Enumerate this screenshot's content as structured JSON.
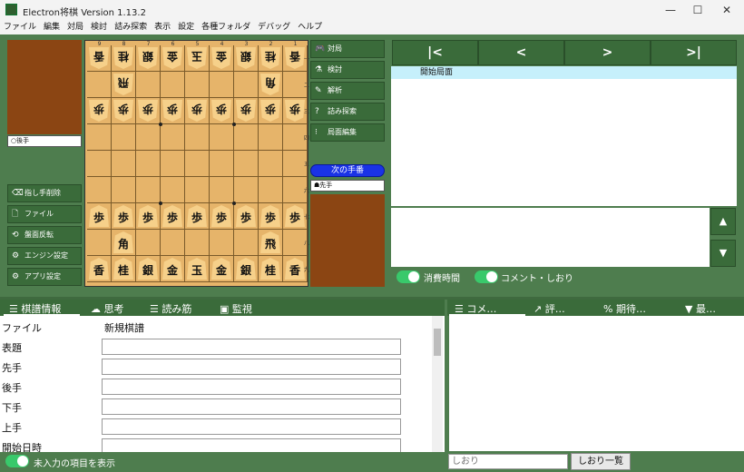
{
  "window": {
    "title": "Electron将棋 Version 1.13.2",
    "minimize": "—",
    "maximize": "☐",
    "close": "✕"
  },
  "menu": [
    "ファイル",
    "編集",
    "対局",
    "検討",
    "詰み探索",
    "表示",
    "設定",
    "各種フォルダ",
    "デバッグ",
    "ヘルプ"
  ],
  "gote_label": "○後手",
  "sente_label": "☗先手",
  "next_turn": "次の手番",
  "file_labels": [
    "9",
    "8",
    "7",
    "6",
    "5",
    "4",
    "3",
    "2",
    "1"
  ],
  "rank_labels": [
    "一",
    "二",
    "三",
    "四",
    "五",
    "六",
    "七",
    "八",
    "九"
  ],
  "board": [
    [
      "香v",
      "桂v",
      "銀v",
      "金v",
      "玉v",
      "金v",
      "銀v",
      "桂v",
      "香v"
    ],
    [
      "",
      "飛v",
      "",
      "",
      "",
      "",
      "",
      "角v",
      ""
    ],
    [
      "歩v",
      "歩v",
      "歩v",
      "歩v",
      "歩v",
      "歩v",
      "歩v",
      "歩v",
      "歩v"
    ],
    [
      "",
      "",
      "",
      "",
      "",
      "",
      "",
      "",
      ""
    ],
    [
      "",
      "",
      "",
      "",
      "",
      "",
      "",
      "",
      ""
    ],
    [
      "",
      "",
      "",
      "",
      "",
      "",
      "",
      "",
      ""
    ],
    [
      "歩",
      "歩",
      "歩",
      "歩",
      "歩",
      "歩",
      "歩",
      "歩",
      "歩"
    ],
    [
      "",
      "角",
      "",
      "",
      "",
      "",
      "",
      "飛",
      ""
    ],
    [
      "香",
      "桂",
      "銀",
      "金",
      "玉",
      "金",
      "銀",
      "桂",
      "香"
    ]
  ],
  "left_buttons": [
    {
      "label": "指し手削除",
      "icon": "⌫"
    },
    {
      "label": "ファイル",
      "icon": "🗋"
    },
    {
      "label": "盤面反転",
      "icon": "⟲"
    },
    {
      "label": "エンジン設定",
      "icon": "⚙"
    },
    {
      "label": "アプリ設定",
      "icon": "⚙"
    }
  ],
  "mid_buttons": [
    {
      "label": "対局",
      "icon": "🎮"
    },
    {
      "label": "検討",
      "icon": "⚗"
    },
    {
      "label": "解析",
      "icon": "✎"
    },
    {
      "label": "詰み探索",
      "icon": "?"
    },
    {
      "label": "局面編集",
      "icon": "⁝"
    }
  ],
  "nav_buttons": [
    "|<",
    "<",
    ">",
    ">|"
  ],
  "record": {
    "selected": "開始局面"
  },
  "scroll_up": "▲",
  "scroll_down": "▼",
  "toggles": {
    "time": "消費時間",
    "comment": "コメント・しおり"
  },
  "left_tabs": [
    {
      "label": "棋譜情報",
      "icon": "☰"
    },
    {
      "label": "思考",
      "icon": "☁"
    },
    {
      "label": "読み筋",
      "icon": "☰"
    },
    {
      "label": "監視",
      "icon": "▣"
    }
  ],
  "right_tabs": [
    {
      "label": "コメ…",
      "icon": "☰"
    },
    {
      "label": "評…",
      "icon": "↗"
    },
    {
      "label": "期待…",
      "icon": "%"
    },
    {
      "label": "最…",
      "icon": "▼"
    }
  ],
  "game_info": [
    {
      "key": "ファイル",
      "value": "新規棋譜"
    },
    {
      "key": "表題",
      "value": ""
    },
    {
      "key": "先手",
      "value": ""
    },
    {
      "key": "後手",
      "value": ""
    },
    {
      "key": "下手",
      "value": ""
    },
    {
      "key": "上手",
      "value": ""
    },
    {
      "key": "開始日時",
      "value": ""
    }
  ],
  "show_empty_toggle": "未入力の項目を表示",
  "bookmark": {
    "placeholder": "しおり",
    "list_button": "しおり一覧"
  },
  "colors": {
    "bg": "#4e7d4e",
    "button": "#3a6b3a",
    "board": "#e6b46a",
    "hand": "#8b4513",
    "selected": "#c6f0fb",
    "turn": "#1a33e6"
  }
}
